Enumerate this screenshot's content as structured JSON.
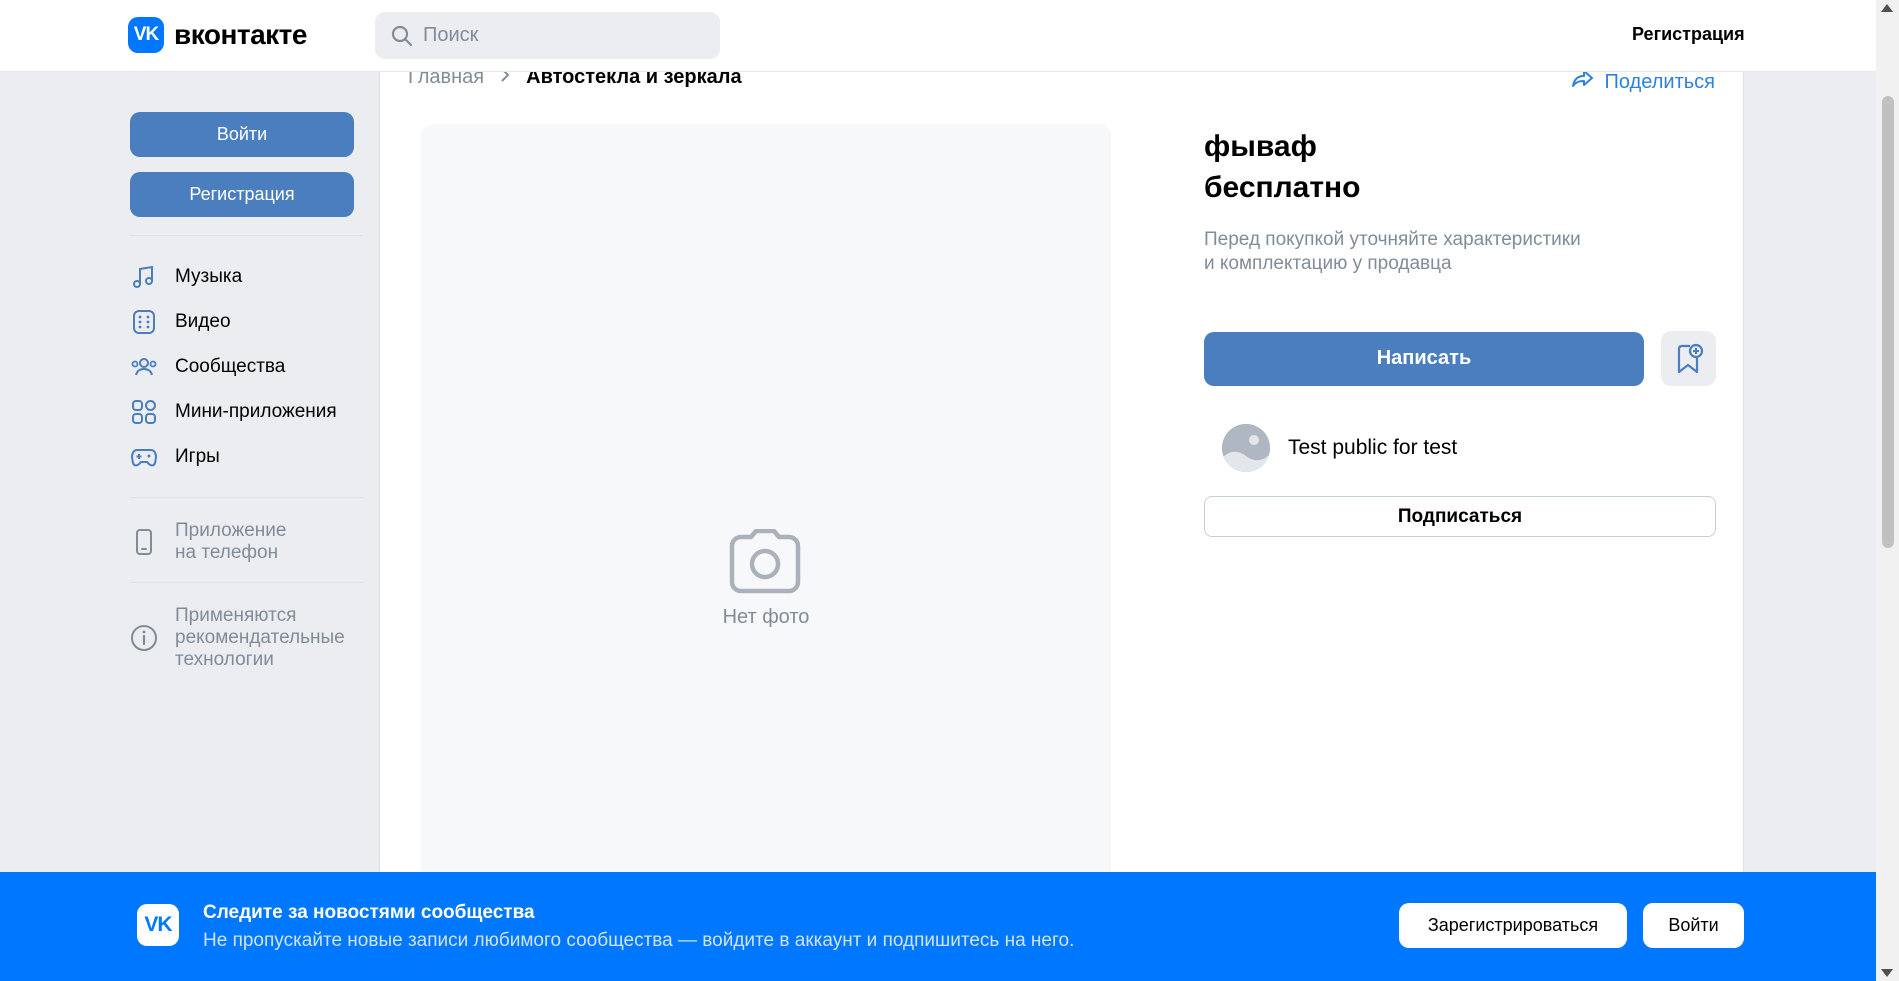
{
  "header": {
    "logo_mark": "VK",
    "logo_text": "вконтакте",
    "search_placeholder": "Поиск",
    "register_label": "Регистрация"
  },
  "sidebar": {
    "login_label": "Войти",
    "register_label": "Регистрация",
    "items": [
      {
        "label": "Музыка",
        "icon": "music-icon"
      },
      {
        "label": "Видео",
        "icon": "video-icon"
      },
      {
        "label": "Сообщества",
        "icon": "communities-icon"
      },
      {
        "label": "Мини-приложения",
        "icon": "mini-apps-icon"
      },
      {
        "label": "Игры",
        "icon": "gamepad-icon"
      }
    ],
    "phone_app_line1": "Приложение",
    "phone_app_line2": "на телефон",
    "tech_line1": "Применяются",
    "tech_line2": "рекомендательные",
    "tech_line3": "технологии"
  },
  "breadcrumb": {
    "home": "Главная",
    "current": "Автостекла и зеркала"
  },
  "share_label": "Поделиться",
  "product": {
    "no_photo": "Нет фото",
    "title_line1": "фываф",
    "title_line2": "бесплатно",
    "desc_line1": "Перед покупкой уточняйте характеристики",
    "desc_line2": "и комплектацию у продавца",
    "write_label": "Написать",
    "group_name": "Test public for test",
    "subscribe_label": "Подписаться"
  },
  "banner": {
    "logo_mark": "VK",
    "title": "Следите за новостями сообщества",
    "subtitle": "Не пропускайте новые записи любимого сообщества — войдите в аккаунт и подпишитесь на него.",
    "register_label": "Зарегистрироваться",
    "login_label": "Войти"
  },
  "colors": {
    "accent": "#4a7ebf",
    "vk_blue": "#0077ff",
    "link": "#2d81e0",
    "muted": "#818c99"
  }
}
